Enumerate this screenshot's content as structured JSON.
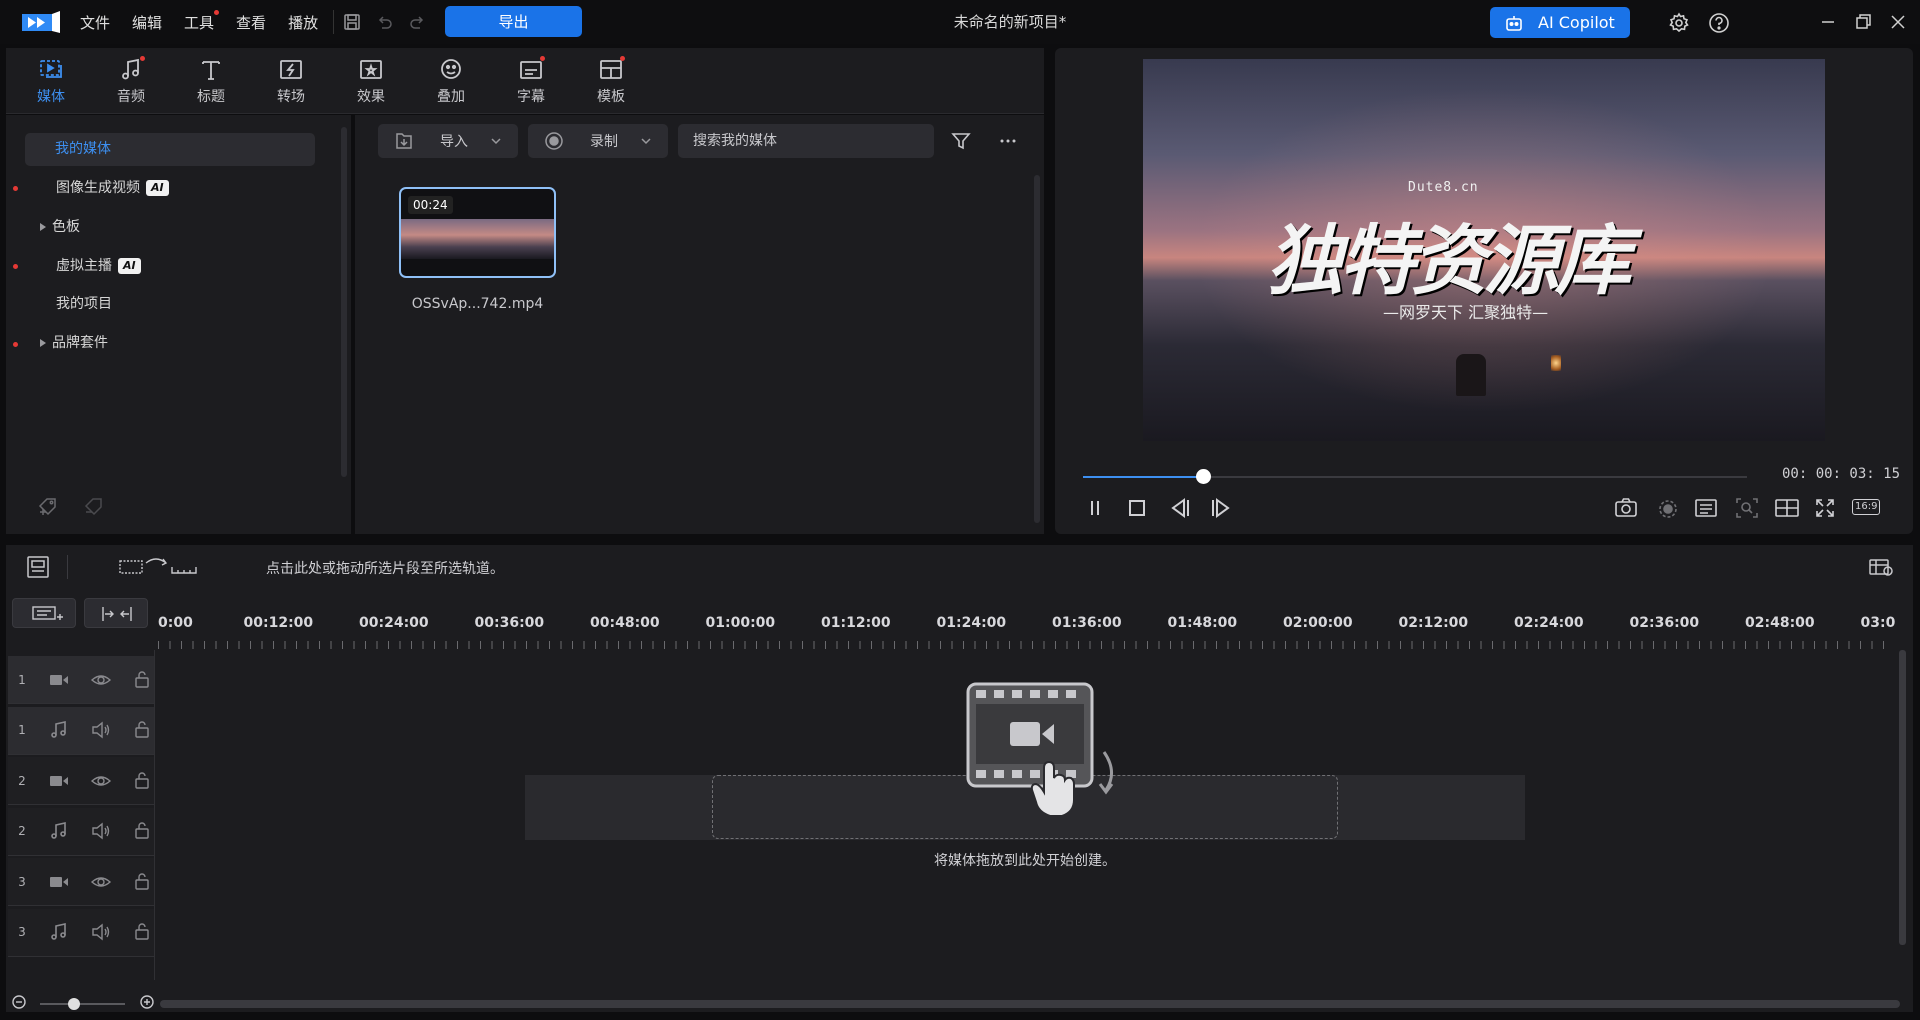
{
  "menu": {
    "items": [
      "文件",
      "编辑",
      "工具",
      "查看",
      "播放"
    ],
    "export_label": "导出",
    "doc_title": "未命名的新项目*",
    "copilot_label": "AI Copilot"
  },
  "tabs": [
    {
      "label": "媒体",
      "icon": "media-icon"
    },
    {
      "label": "音频",
      "icon": "music-note-icon"
    },
    {
      "label": "标题",
      "icon": "text-t-icon"
    },
    {
      "label": "转场",
      "icon": "transition-icon"
    },
    {
      "label": "效果",
      "icon": "effects-icon"
    },
    {
      "label": "叠加",
      "icon": "overlay-icon"
    },
    {
      "label": "字幕",
      "icon": "subtitle-icon"
    },
    {
      "label": "模板",
      "icon": "template-icon"
    }
  ],
  "library": {
    "items": [
      {
        "label": "我的媒体"
      },
      {
        "label": "图像生成视频",
        "badge": "AI"
      },
      {
        "label": "色板"
      },
      {
        "label": "虚拟主播",
        "badge": "AI"
      },
      {
        "label": "我的项目"
      },
      {
        "label": "品牌套件"
      }
    ],
    "import_label": "导入",
    "record_label": "录制",
    "search_placeholder": "搜索我的媒体",
    "clip": {
      "duration": "00:24",
      "filename": "OSSvAp...742.mp4"
    }
  },
  "preview": {
    "watermark_url": "Dute8.cn",
    "watermark_title": "独特资源库",
    "watermark_sub": "—网罗天下  汇聚独特—",
    "timecode": "00: 00: 03: 15",
    "progress": 0.18,
    "aspect": "16:9"
  },
  "timeline": {
    "hint": "点击此处或拖动所选片段至所选轨道。",
    "ruler": [
      "0:00",
      "00:12:00",
      "00:24:00",
      "00:36:00",
      "00:48:00",
      "01:00:00",
      "01:12:00",
      "01:24:00",
      "01:36:00",
      "01:48:00",
      "02:00:00",
      "02:12:00",
      "02:24:00",
      "02:36:00",
      "02:48:00",
      "03:0"
    ],
    "tracks": [
      {
        "num": "1",
        "type": "video"
      },
      {
        "num": "1",
        "type": "audio"
      },
      {
        "num": "2",
        "type": "video"
      },
      {
        "num": "2",
        "type": "audio"
      },
      {
        "num": "3",
        "type": "video"
      },
      {
        "num": "3",
        "type": "audio"
      }
    ],
    "drop_hint": "将媒体拖放到此处开始创建。",
    "zoom_level": 0.4
  },
  "colors": {
    "accent": "#1a73e8",
    "active_tab": "#3d8ff0",
    "notify": "#e53935"
  }
}
